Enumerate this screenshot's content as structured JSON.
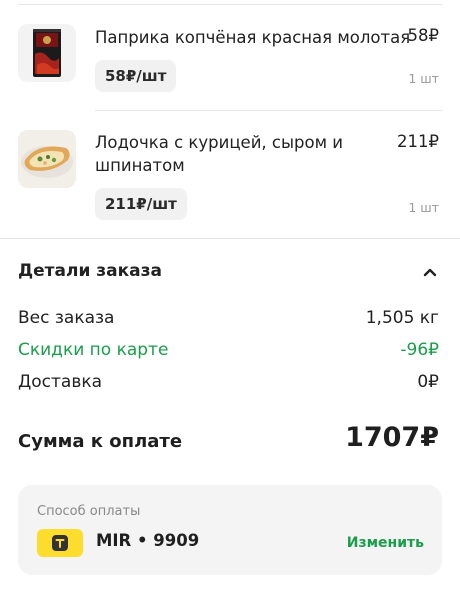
{
  "items": [
    {
      "name": "Паприка копчёная красная молотая",
      "price": "58₽",
      "unit_price": "58₽/шт",
      "quantity": "1 шт",
      "image": "paprika-package-image"
    },
    {
      "name_line1": "Лодочка с курицей, сыром и",
      "name_line2": "шпинатом",
      "price": "211₽",
      "unit_price": "211₽/шт",
      "quantity": "1 шт",
      "image": "chicken-boat-pastry-image"
    }
  ],
  "order_details": {
    "title": "Детали заказа",
    "toggle_icon": "chevron-up-icon",
    "rows": [
      {
        "label": "Вес заказа",
        "value": "1,505 кг"
      },
      {
        "label": "Скидки по карте",
        "value": "-96₽"
      },
      {
        "label": "Доставка",
        "value": "0₽"
      }
    ],
    "total_label": "Сумма к оплате",
    "total_value": "1707₽"
  },
  "payment": {
    "title": "Способ оплаты",
    "bank_icon": "tinkoff-bank-icon",
    "card": "MIR • 9909",
    "change_label": "Изменить"
  },
  "colors": {
    "accent_green": "#1a9e4b",
    "bank_yellow": "#ffdd2d",
    "badge_bg": "#f1f1f1",
    "card_bg": "#f4f4f4"
  }
}
